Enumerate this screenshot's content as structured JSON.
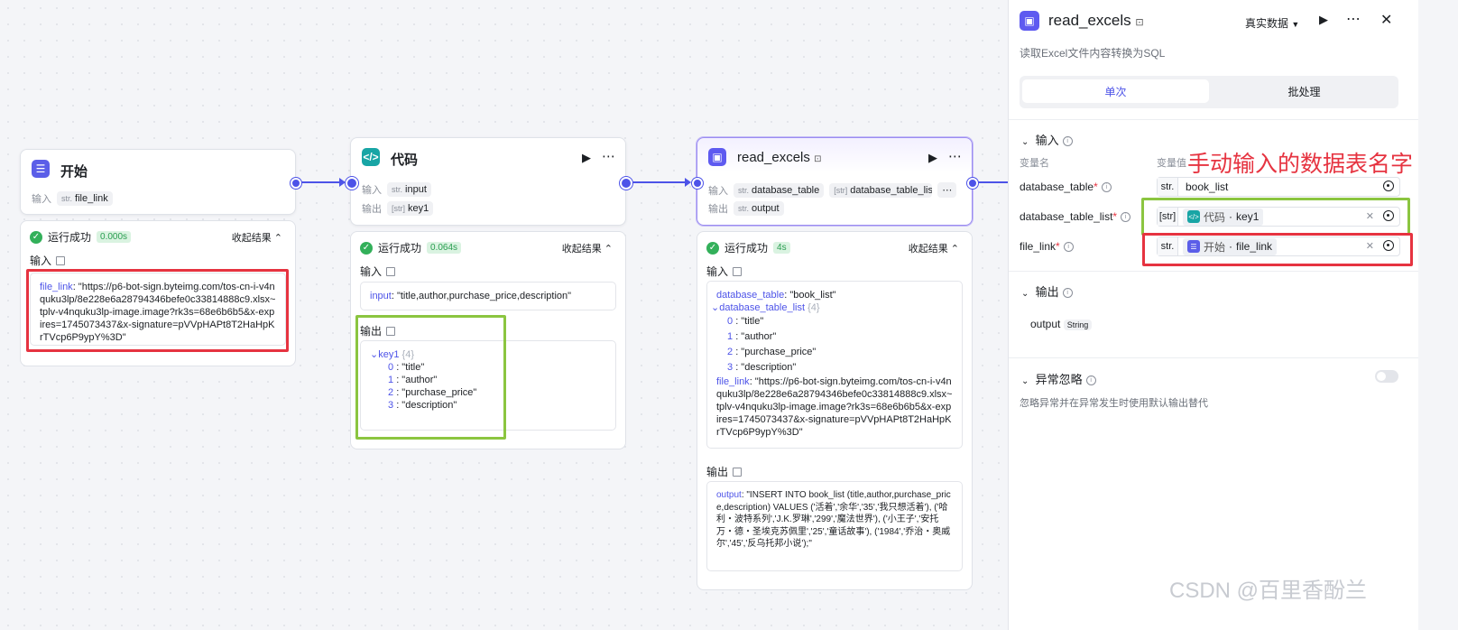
{
  "nodes": {
    "start": {
      "title": "开始",
      "input_label": "输入",
      "input_param_type": "str.",
      "input_param": "file_link",
      "result": {
        "status": "运行成功",
        "time": "0.000s",
        "collapse": "收起结果",
        "input_label": "输入",
        "input_key": "file_link",
        "input_value": ": \"https://p6-bot-sign.byteimg.com/tos-cn-i-v4nquku3lp/8e228e6a28794346befe0c33814888c9.xlsx~tplv-v4nquku3lp-image.image?rk3s=68e6b6b5&x-expires=1745073437&x-signature=pVVpHAPt8T2HaHpKrTVcp6P9ypY%3D\""
      }
    },
    "code": {
      "title": "代码",
      "input_label": "输入",
      "input_type": "str.",
      "input_param": "input",
      "output_label": "输出",
      "output_type": "[str]",
      "output_param": "key1",
      "result": {
        "status": "运行成功",
        "time": "0.064s",
        "collapse": "收起结果",
        "input_label": "输入",
        "input_key": "input",
        "input_value": ": \"title,author,purchase_price,description\"",
        "output_label": "输出",
        "output_key": "key1",
        "output_count": "{4}",
        "output_items": [
          {
            "idx": "0",
            "val": ": \"title\""
          },
          {
            "idx": "1",
            "val": ": \"author\""
          },
          {
            "idx": "2",
            "val": ": \"purchase_price\""
          },
          {
            "idx": "3",
            "val": ": \"description\""
          }
        ]
      }
    },
    "read": {
      "title": "read_excels",
      "input_label": "输入",
      "input_type1": "str.",
      "input_param1": "database_table",
      "input_type2": "[str]",
      "input_param2": "database_table_list",
      "output_label": "输出",
      "output_type": "str.",
      "output_param": "output",
      "result": {
        "status": "运行成功",
        "time": "4s",
        "collapse": "收起结果",
        "input_label": "输入",
        "db_key": "database_table",
        "db_val": ": \"book_list\"",
        "list_key": "database_table_list",
        "list_count": "{4}",
        "list_items": [
          {
            "idx": "0",
            "val": ": \"title\""
          },
          {
            "idx": "1",
            "val": ": \"author\""
          },
          {
            "idx": "2",
            "val": ": \"purchase_price\""
          },
          {
            "idx": "3",
            "val": ": \"description\""
          }
        ],
        "file_key": "file_link",
        "file_val": ": \"https://p6-bot-sign.byteimg.com/tos-cn-i-v4nquku3lp/8e228e6a28794346befe0c33814888c9.xlsx~tplv-v4nquku3lp-image.image?rk3s=68e6b6b5&x-expires=1745073437&x-signature=pVVpHAPt8T2HaHpKrTVcp6P9ypY%3D\"",
        "output_label": "输出",
        "out_key": "output",
        "out_val": ": \"INSERT INTO book_list (title,author,purchase_price,description) VALUES ('活着','余华','35','我只想活着'), ('哈利・波特系列','J.K.罗琳','299','魔法世界'), ('小王子','安托万・德・圣埃克苏佩里','25','童话故事'), ('1984','乔治・奥威尔','45','反乌托邦小说');\""
      }
    }
  },
  "sidebar": {
    "title": "read_excels",
    "mode": "真实数据",
    "description": "读取Excel文件内容转换为SQL",
    "tabs": [
      "单次",
      "批处理"
    ],
    "input_section": "输入",
    "col_name": "变量名",
    "col_value": "变量值",
    "annotation": "手动输入的数据表名字",
    "fields": [
      {
        "name": "database_table",
        "type": "str.",
        "value": "book_list"
      },
      {
        "name": "database_table_list",
        "type": "[str]",
        "ref_node": "代码",
        "ref_var": "key1"
      },
      {
        "name": "file_link",
        "type": "str.",
        "ref_node": "开始",
        "ref_var": "file_link"
      }
    ],
    "output_section": "输出",
    "output_name": "output",
    "output_type": "String",
    "exception_section": "异常忽略",
    "exception_desc": "忽略异常并在异常发生时使用默认输出替代"
  },
  "watermark": "CSDN @百里香酚兰",
  "colors": {
    "accent": "#4d53e8",
    "success": "#33b05a",
    "red_annotation": "#e63340",
    "green_annotation": "#8bc540"
  }
}
